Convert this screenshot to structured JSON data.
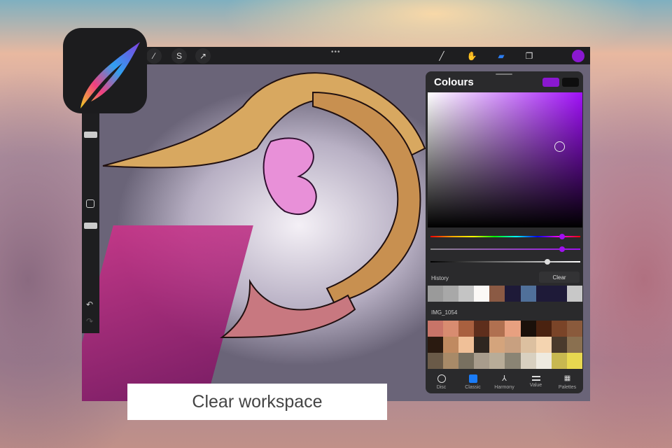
{
  "caption": "Clear workspace",
  "panel": {
    "title": "Colours",
    "primary_color": "#8a18d0",
    "secondary_color": "#0e0e0e",
    "history_label": "History",
    "clear_label": "Clear",
    "palette_name": "IMG_1054",
    "history": [
      "#9a9a9a",
      "#a8a8a8",
      "#c4c4c4",
      "#fbf8f6",
      "#8b5a44",
      "#1e1a38",
      "#50709a",
      "#1e1a38",
      "#1e1a38",
      "#c8c8c8"
    ],
    "palette": [
      [
        "#c87468",
        "#d88c70",
        "#a9603f",
        "#5e2e1c",
        "#b07050",
        "#e8a080",
        "#1a100a",
        "#4a2210",
        "#7a4428",
        "#8a5a3c"
      ],
      [
        "#2a1a10",
        "#c08a60",
        "#f0c098",
        "#2e2620",
        "#d4a47c",
        "#c8a080",
        "#dcc0a0",
        "#f4d4b0",
        "#4a3a2c",
        "#8a7050"
      ],
      [
        "#6a5a48",
        "#a88a68",
        "#787060",
        "#a89c8c",
        "#b8ac98",
        "#8a8474",
        "#d8d0c0",
        "#eeeae0",
        "#c8b850",
        "#e8d850"
      ]
    ],
    "tabs": [
      {
        "label": "Disc",
        "icon": "disc-icon"
      },
      {
        "label": "Classic",
        "icon": "classic-icon"
      },
      {
        "label": "Harmony",
        "icon": "harmony-icon"
      },
      {
        "label": "Value",
        "icon": "value-icon"
      },
      {
        "label": "Palettes",
        "icon": "palettes-icon"
      }
    ],
    "hue": 0.86,
    "saturation": 0.86,
    "brightness": 0.76
  }
}
